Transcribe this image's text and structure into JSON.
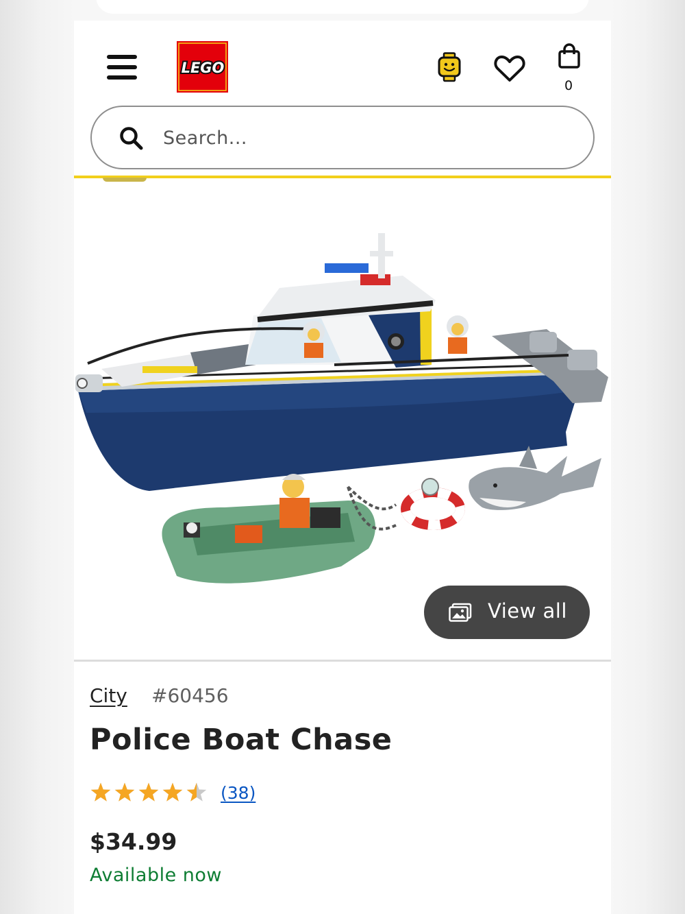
{
  "header": {
    "menu_icon": "hamburger-icon",
    "logo_text": "LEGO",
    "account_icon": "minifig-head-icon",
    "wishlist_icon": "heart-icon",
    "bag_icon": "shopping-bag-icon",
    "bag_count": "0"
  },
  "search": {
    "icon": "search-icon",
    "placeholder": "Search..."
  },
  "gallery": {
    "image_subject": "LEGO City Police Boat Chase set",
    "view_all_icon": "image-icon",
    "view_all_label": "View all"
  },
  "product": {
    "theme": "City",
    "item_number": "#60456",
    "name": "Police Boat Chase",
    "rating": 4.5,
    "rating_max": 5,
    "review_count": "(38)",
    "price": "$34.99",
    "availability": "Available now"
  },
  "colors": {
    "brand_red": "#e3000b",
    "brand_yellow": "#f2cf1b",
    "link_blue": "#0a56c2",
    "availability_green": "#0e7d33",
    "star_orange": "#f5a623"
  }
}
